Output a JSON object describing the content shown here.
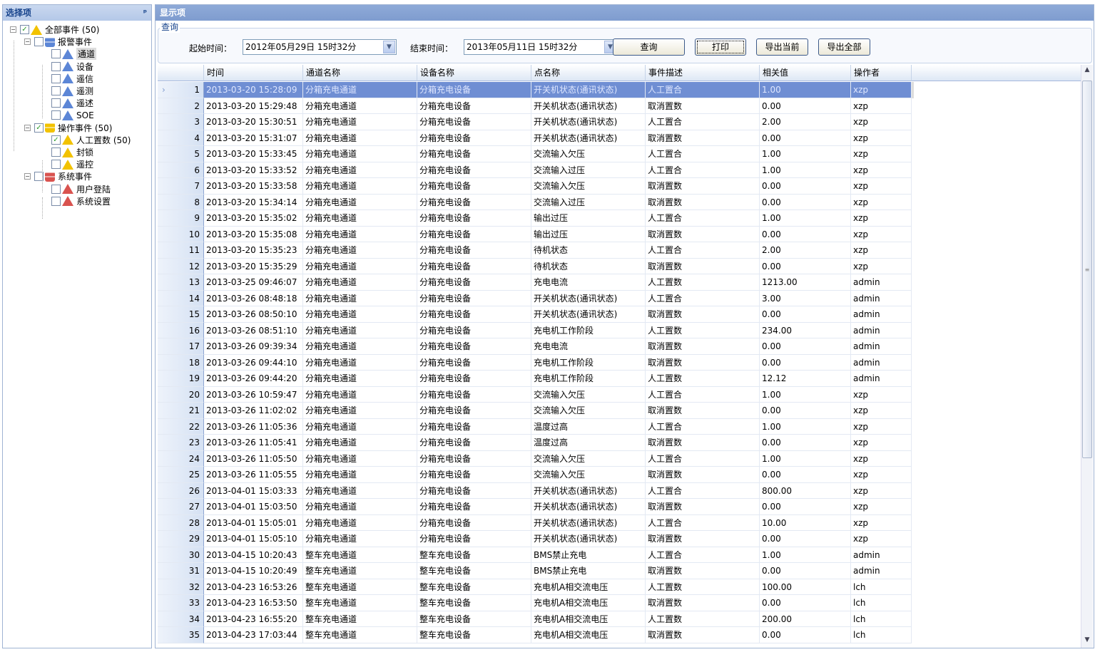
{
  "left_panel": {
    "title": "选择项",
    "pin_icon": "pin-icon",
    "tree": [
      {
        "label": "全部事件 (50)",
        "checked": true,
        "level": 0,
        "icon": "warning-yellow"
      },
      {
        "label": "报警事件",
        "checked": false,
        "level": 1,
        "icon": "db-blue"
      },
      {
        "label": "通道",
        "checked": false,
        "level": 2,
        "icon": "warning-blue",
        "selected": true
      },
      {
        "label": "设备",
        "checked": false,
        "level": 2,
        "icon": "warning-blue"
      },
      {
        "label": "遥信",
        "checked": false,
        "level": 2,
        "icon": "warning-blue"
      },
      {
        "label": "遥测",
        "checked": false,
        "level": 2,
        "icon": "warning-blue"
      },
      {
        "label": "遥述",
        "checked": false,
        "level": 2,
        "icon": "warning-blue"
      },
      {
        "label": "SOE",
        "checked": false,
        "level": 2,
        "icon": "warning-blue"
      },
      {
        "label": "操作事件 (50)",
        "checked": true,
        "level": 1,
        "icon": "db-yellow"
      },
      {
        "label": "人工置数 (50)",
        "checked": true,
        "level": 2,
        "icon": "warning-yellow"
      },
      {
        "label": "封锁",
        "checked": false,
        "level": 2,
        "icon": "warning-yellow"
      },
      {
        "label": "遥控",
        "checked": false,
        "level": 2,
        "icon": "warning-yellow"
      },
      {
        "label": "系统事件",
        "checked": false,
        "level": 1,
        "icon": "db-red"
      },
      {
        "label": "用户登陆",
        "checked": false,
        "level": 2,
        "icon": "warning-red"
      },
      {
        "label": "系统设置",
        "checked": false,
        "level": 2,
        "icon": "warning-red"
      }
    ]
  },
  "right_panel": {
    "title": "显示项",
    "query_group": "查询",
    "start_label": "起始时间：",
    "start_value": "2012年05月29日 15时32分",
    "end_label": "结束时间：",
    "end_value": "2013年05月11日 15时32分",
    "buttons": {
      "query": "查询",
      "print": "打印",
      "export_current": "导出当前",
      "export_all": "导出全部"
    }
  },
  "table": {
    "columns": [
      "时间",
      "通道名称",
      "设备名称",
      "点名称",
      "事件描述",
      "相关值",
      "操作者"
    ],
    "selected_row": 0,
    "rows": [
      [
        "2013-03-20 15:28:09",
        "分箱充电通道",
        "分箱充电设备",
        "开关机状态(通讯状态)",
        "人工置合",
        "1.00",
        "xzp"
      ],
      [
        "2013-03-20 15:29:48",
        "分箱充电通道",
        "分箱充电设备",
        "开关机状态(通讯状态)",
        "取消置数",
        "0.00",
        "xzp"
      ],
      [
        "2013-03-20 15:30:51",
        "分箱充电通道",
        "分箱充电设备",
        "开关机状态(通讯状态)",
        "人工置合",
        "2.00",
        "xzp"
      ],
      [
        "2013-03-20 15:31:07",
        "分箱充电通道",
        "分箱充电设备",
        "开关机状态(通讯状态)",
        "取消置数",
        "0.00",
        "xzp"
      ],
      [
        "2013-03-20 15:33:45",
        "分箱充电通道",
        "分箱充电设备",
        "交流输入欠压",
        "人工置合",
        "1.00",
        "xzp"
      ],
      [
        "2013-03-20 15:33:52",
        "分箱充电通道",
        "分箱充电设备",
        "交流输入过压",
        "人工置合",
        "1.00",
        "xzp"
      ],
      [
        "2013-03-20 15:33:58",
        "分箱充电通道",
        "分箱充电设备",
        "交流输入欠压",
        "取消置数",
        "0.00",
        "xzp"
      ],
      [
        "2013-03-20 15:34:14",
        "分箱充电通道",
        "分箱充电设备",
        "交流输入过压",
        "取消置数",
        "0.00",
        "xzp"
      ],
      [
        "2013-03-20 15:35:02",
        "分箱充电通道",
        "分箱充电设备",
        "输出过压",
        "人工置合",
        "1.00",
        "xzp"
      ],
      [
        "2013-03-20 15:35:08",
        "分箱充电通道",
        "分箱充电设备",
        "输出过压",
        "取消置数",
        "0.00",
        "xzp"
      ],
      [
        "2013-03-20 15:35:23",
        "分箱充电通道",
        "分箱充电设备",
        "待机状态",
        "人工置合",
        "2.00",
        "xzp"
      ],
      [
        "2013-03-20 15:35:29",
        "分箱充电通道",
        "分箱充电设备",
        "待机状态",
        "取消置数",
        "0.00",
        "xzp"
      ],
      [
        "2013-03-25 09:46:07",
        "分箱充电通道",
        "分箱充电设备",
        "充电电流",
        "人工置数",
        "1213.00",
        "admin"
      ],
      [
        "2013-03-26 08:48:18",
        "分箱充电通道",
        "分箱充电设备",
        "开关机状态(通讯状态)",
        "人工置合",
        "3.00",
        "admin"
      ],
      [
        "2013-03-26 08:50:10",
        "分箱充电通道",
        "分箱充电设备",
        "开关机状态(通讯状态)",
        "取消置数",
        "0.00",
        "admin"
      ],
      [
        "2013-03-26 08:51:10",
        "分箱充电通道",
        "分箱充电设备",
        "充电机工作阶段",
        "人工置数",
        "234.00",
        "admin"
      ],
      [
        "2013-03-26 09:39:34",
        "分箱充电通道",
        "分箱充电设备",
        "充电电流",
        "取消置数",
        "0.00",
        "admin"
      ],
      [
        "2013-03-26 09:44:10",
        "分箱充电通道",
        "分箱充电设备",
        "充电机工作阶段",
        "取消置数",
        "0.00",
        "admin"
      ],
      [
        "2013-03-26 09:44:20",
        "分箱充电通道",
        "分箱充电设备",
        "充电机工作阶段",
        "人工置数",
        "12.12",
        "admin"
      ],
      [
        "2013-03-26 10:59:47",
        "分箱充电通道",
        "分箱充电设备",
        "交流输入欠压",
        "人工置合",
        "1.00",
        "xzp"
      ],
      [
        "2013-03-26 11:02:02",
        "分箱充电通道",
        "分箱充电设备",
        "交流输入欠压",
        "取消置数",
        "0.00",
        "xzp"
      ],
      [
        "2013-03-26 11:05:36",
        "分箱充电通道",
        "分箱充电设备",
        "温度过高",
        "人工置合",
        "1.00",
        "xzp"
      ],
      [
        "2013-03-26 11:05:41",
        "分箱充电通道",
        "分箱充电设备",
        "温度过高",
        "取消置数",
        "0.00",
        "xzp"
      ],
      [
        "2013-03-26 11:05:50",
        "分箱充电通道",
        "分箱充电设备",
        "交流输入欠压",
        "人工置合",
        "1.00",
        "xzp"
      ],
      [
        "2013-03-26 11:05:55",
        "分箱充电通道",
        "分箱充电设备",
        "交流输入欠压",
        "取消置数",
        "0.00",
        "xzp"
      ],
      [
        "2013-04-01 15:03:33",
        "分箱充电通道",
        "分箱充电设备",
        "开关机状态(通讯状态)",
        "人工置合",
        "800.00",
        "xzp"
      ],
      [
        "2013-04-01 15:03:50",
        "分箱充电通道",
        "分箱充电设备",
        "开关机状态(通讯状态)",
        "取消置数",
        "0.00",
        "xzp"
      ],
      [
        "2013-04-01 15:05:01",
        "分箱充电通道",
        "分箱充电设备",
        "开关机状态(通讯状态)",
        "人工置合",
        "10.00",
        "xzp"
      ],
      [
        "2013-04-01 15:05:10",
        "分箱充电通道",
        "分箱充电设备",
        "开关机状态(通讯状态)",
        "取消置数",
        "0.00",
        "xzp"
      ],
      [
        "2013-04-15 10:20:43",
        "整车充电通道",
        "整车充电设备",
        "BMS禁止充电",
        "人工置合",
        "1.00",
        "admin"
      ],
      [
        "2013-04-15 10:20:49",
        "整车充电通道",
        "整车充电设备",
        "BMS禁止充电",
        "取消置数",
        "0.00",
        "admin"
      ],
      [
        "2013-04-23 16:53:26",
        "整车充电通道",
        "整车充电设备",
        "充电机A相交流电压",
        "人工置数",
        "100.00",
        "lch"
      ],
      [
        "2013-04-23 16:53:50",
        "整车充电通道",
        "整车充电设备",
        "充电机A相交流电压",
        "取消置数",
        "0.00",
        "lch"
      ],
      [
        "2013-04-23 16:55:20",
        "整车充电通道",
        "整车充电设备",
        "充电机A相交流电压",
        "人工置数",
        "200.00",
        "lch"
      ],
      [
        "2013-04-23 17:03:44",
        "整车充电通道",
        "整车充电设备",
        "充电机A相交流电压",
        "取消置数",
        "0.00",
        "lch"
      ]
    ]
  },
  "colors": {
    "selection": "#6f8ed3",
    "header": "#8eaad8",
    "accent": "#15428b"
  }
}
